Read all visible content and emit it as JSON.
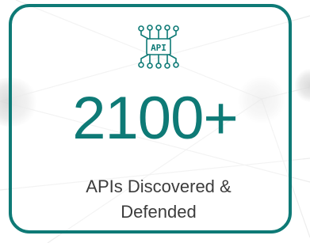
{
  "stat": {
    "value": "2100+",
    "caption_line1": "APIs Discovered &",
    "caption_line2": "Defended",
    "icon_label": "API",
    "icon": "api-chip-icon"
  },
  "colors": {
    "accent": "#0e7a76",
    "caption_text": "#3c3c3c",
    "background": "#ffffff"
  }
}
